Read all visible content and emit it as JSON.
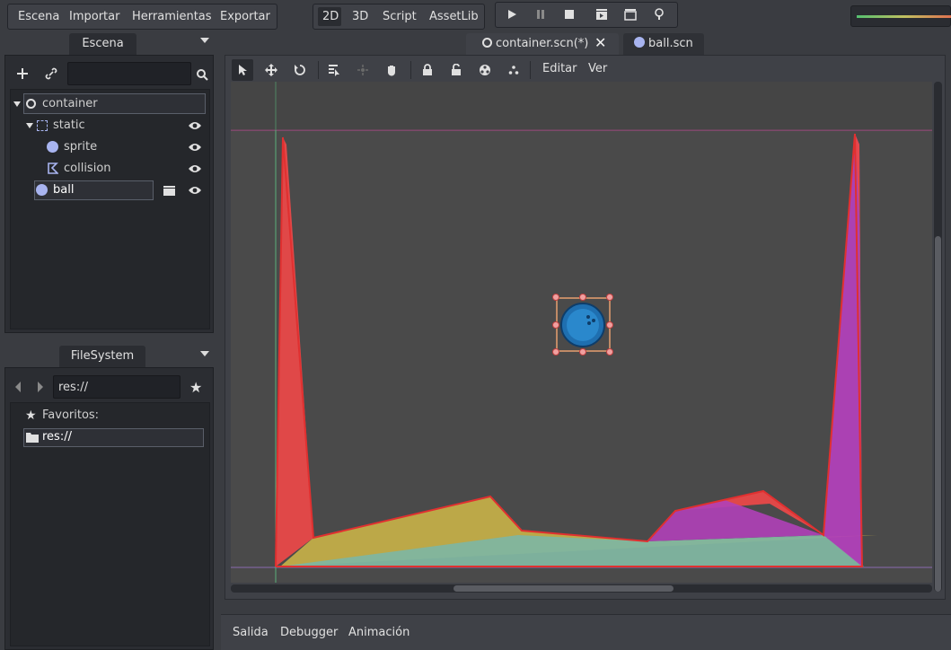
{
  "menu": {
    "scene": "Escena",
    "import": "Importar",
    "tools": "Herramientas",
    "export": "Exportar"
  },
  "modes": {
    "d2": "2D",
    "d3": "3D",
    "script": "Script",
    "assetlib": "AssetLib"
  },
  "playback": {
    "icons": [
      "play-icon",
      "pause-icon",
      "stop-icon",
      "play-scene-icon",
      "play-custom-scene-icon",
      "debug-options-icon"
    ]
  },
  "scene_panel": {
    "tab_label": "Escena",
    "search_placeholder": "",
    "tree": [
      {
        "label": "container",
        "icon": "node-circle-icon"
      },
      {
        "label": "static",
        "icon": "static-body-icon"
      },
      {
        "label": "sprite",
        "icon": "sprite-icon"
      },
      {
        "label": "collision",
        "icon": "collision-polygon-icon"
      },
      {
        "label": "ball",
        "icon": "ball-scene-icon"
      }
    ]
  },
  "filesystem": {
    "tab_label": "FileSystem",
    "path": "res://",
    "favorites_label": "Favoritos:",
    "root_item": "res://"
  },
  "editor_tabs": [
    {
      "label": "container.scn(*)",
      "active": true
    },
    {
      "label": "ball.scn",
      "active": false
    }
  ],
  "canvas_toolbar": {
    "edit_menu": "Editar",
    "view_menu": "Ver"
  },
  "bottom_tabs": {
    "output": "Salida",
    "debugger": "Debugger",
    "animation": "Animación"
  },
  "colors": {
    "accent": "#e04a4a",
    "selection": "#e8a070",
    "polygon_red": "#e84848",
    "polygon_yellow": "#c9b248",
    "polygon_purple": "#b040b8",
    "polygon_teal": "#7fb5a0"
  }
}
